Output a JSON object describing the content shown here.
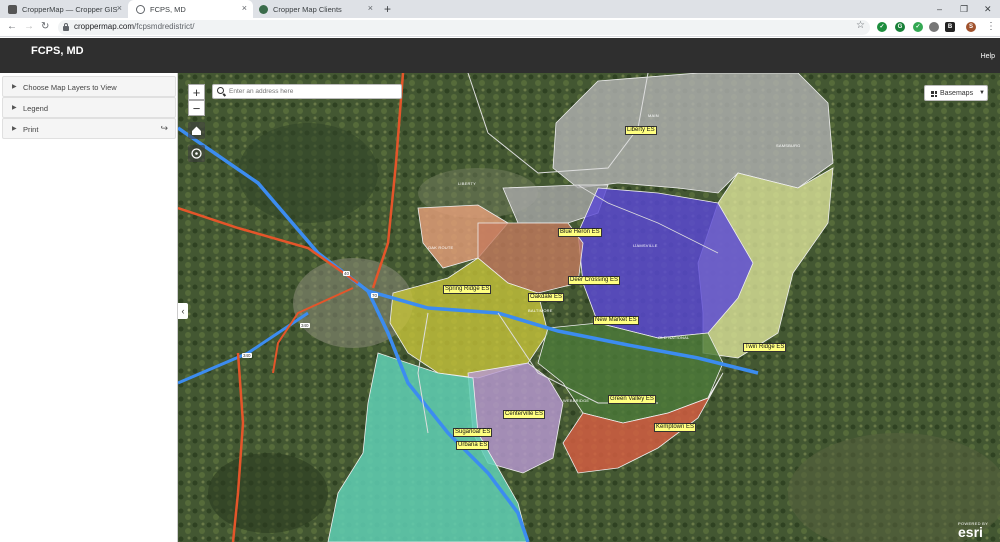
{
  "browser": {
    "tabs": [
      {
        "title": "CropperMap — Cropper GIS",
        "active": false
      },
      {
        "title": "FCPS, MD",
        "active": true
      },
      {
        "title": "Cropper Map Clients",
        "active": false
      }
    ],
    "url_host": "croppermap.com",
    "url_path": "/fcpsmdredistrict/",
    "profile_initial": "S",
    "extension_badge": "B"
  },
  "app": {
    "title": "FCPS, MD",
    "help_label": "Help"
  },
  "panel": {
    "items": [
      {
        "label": "Choose Map Layers to View"
      },
      {
        "label": "Legend"
      },
      {
        "label": "Print"
      }
    ]
  },
  "map": {
    "search_placeholder": "Enter an address here",
    "basemaps_label": "Basemaps",
    "zoom_in": "+",
    "zoom_out": "−",
    "attribution_small": "POWERED BY",
    "attribution_logo": "esri",
    "schools": [
      {
        "name": "Liberty ES"
      },
      {
        "name": "Blue Heron ES"
      },
      {
        "name": "Spring Ridge ES"
      },
      {
        "name": "Oakdale ES"
      },
      {
        "name": "Deer Crossing ES"
      },
      {
        "name": "New Market ES"
      },
      {
        "name": "Twin Ridge ES"
      },
      {
        "name": "Centerville ES"
      },
      {
        "name": "Green Valley ES"
      },
      {
        "name": "Kemptown ES"
      },
      {
        "name": "Sugarloaf ES"
      },
      {
        "name": "Urbana ES"
      }
    ],
    "road_labels": [
      {
        "text": "LIBERTY"
      },
      {
        "text": "OAK ROUTE"
      },
      {
        "text": "MAIN"
      },
      {
        "text": "OLD NATIONAL"
      },
      {
        "text": "SAMSBURG"
      },
      {
        "text": "WEBBRIDGE"
      },
      {
        "text": "BALTIMORE"
      },
      {
        "text": "IJAMSVILLE"
      }
    ],
    "route_shields": [
      {
        "text": "40"
      },
      {
        "text": "70"
      },
      {
        "text": "340"
      },
      {
        "text": "340"
      }
    ]
  }
}
